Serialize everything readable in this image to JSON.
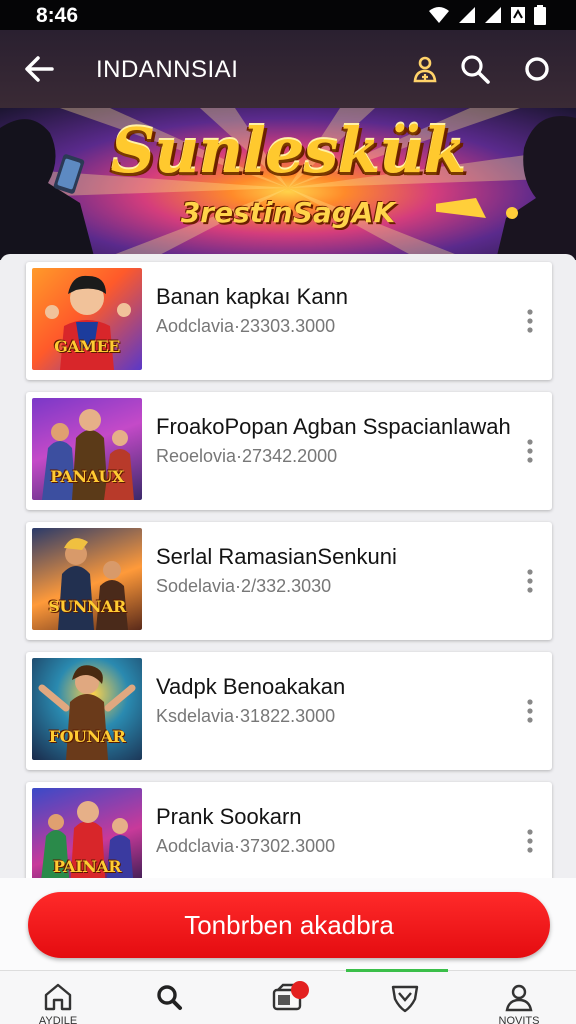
{
  "status_bar": {
    "time": "8:46"
  },
  "app_bar": {
    "title": "INDANNSIAI"
  },
  "banner": {
    "title": "Sunleskük",
    "subtitle": "3restinSagAK"
  },
  "games": [
    {
      "title": "Banan kapkaı Kann",
      "subtitle": "Aodclavia·23303.3000",
      "thumb_text": "GAMEE"
    },
    {
      "title": "FroakoPopan Agban Sspacianlawah",
      "subtitle": "Reoelovia·27342.2000",
      "thumb_text": "PANAUX"
    },
    {
      "title": "Serlal RamasianSenkuni",
      "subtitle": "Sodelavia·2/332.3030",
      "thumb_text": "SUNNAR"
    },
    {
      "title": "Vadpk Benoakakan",
      "subtitle": "Ksdelavia·31822.3000",
      "thumb_text": "FOUNAR"
    },
    {
      "title": "Prank Sookarn",
      "subtitle": "Aodclavia·37302.3000",
      "thumb_text": "PAINAR"
    }
  ],
  "cta": {
    "label": "Tonbrben akadbra"
  },
  "bottom_nav": {
    "items": [
      {
        "label": "AYDILE",
        "icon": "home-icon"
      },
      {
        "label": "",
        "icon": "search-icon"
      },
      {
        "label": "",
        "icon": "games-icon",
        "badge": ""
      },
      {
        "label": "",
        "icon": "shield-icon"
      },
      {
        "label": "NOVITS",
        "icon": "profile-icon"
      }
    ]
  },
  "colors": {
    "accent": "#e40c10",
    "nav_indicator": "#3bbf4a",
    "app_bar": "#2a2030"
  }
}
